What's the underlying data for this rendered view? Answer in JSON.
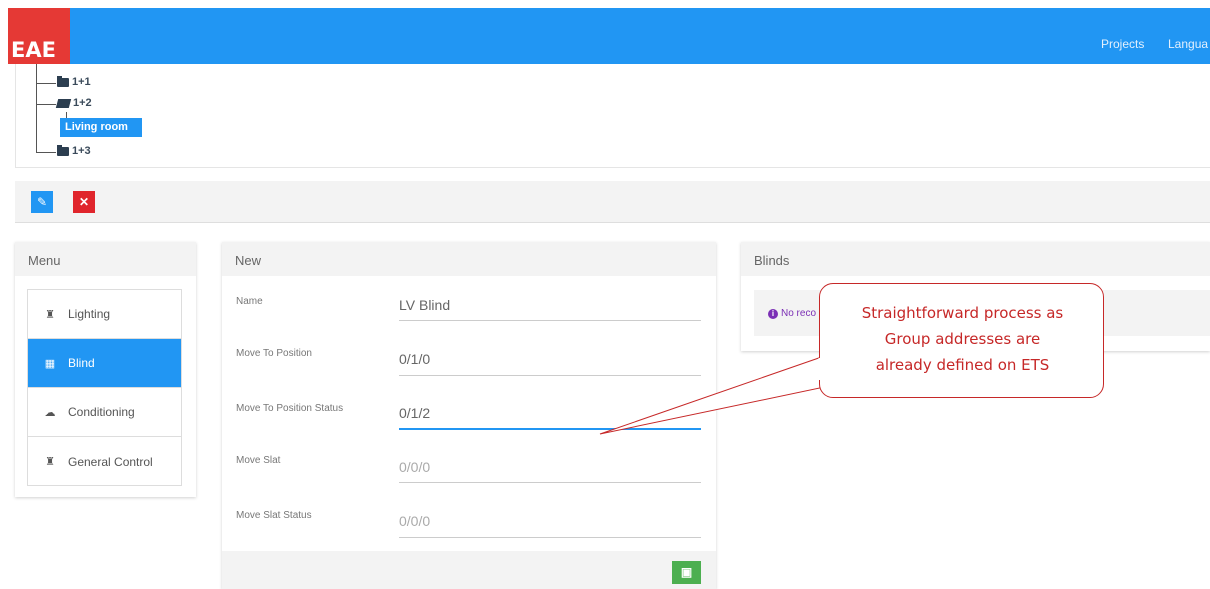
{
  "app": {
    "logo": "EAE",
    "nav": {
      "projects": "Projects",
      "language": "Langua"
    }
  },
  "tree": {
    "nodes": [
      "1+1",
      "1+2",
      "Living room",
      "1+3"
    ]
  },
  "menu": {
    "title": "Menu",
    "items": [
      {
        "label": "Lighting",
        "icon": "lamp-icon"
      },
      {
        "label": "Blind",
        "icon": "grid-icon"
      },
      {
        "label": "Conditioning",
        "icon": "cloud-icon"
      },
      {
        "label": "General Control",
        "icon": "lamp-icon"
      }
    ],
    "active": "Blind"
  },
  "form": {
    "title": "New",
    "fields": [
      {
        "label": "Name",
        "value": "LV Blind"
      },
      {
        "label": "Move To Position",
        "value": "0/1/0"
      },
      {
        "label": "Move To Position Status",
        "value": "0/1/2"
      },
      {
        "label": "Move Slat",
        "placeholder": "0/0/0"
      },
      {
        "label": "Move Slat Status",
        "placeholder": "0/0/0"
      }
    ]
  },
  "blinds": {
    "title": "Blinds",
    "notice": "No reco"
  },
  "callout": {
    "line1": "Straightforward process as",
    "line2": "Group addresses are",
    "line3": "already defined on ETS"
  },
  "colors": {
    "primary": "#2196f3",
    "logo": "#e53935",
    "danger": "#e0252c",
    "success": "#4caf50",
    "callout": "#c62828"
  }
}
